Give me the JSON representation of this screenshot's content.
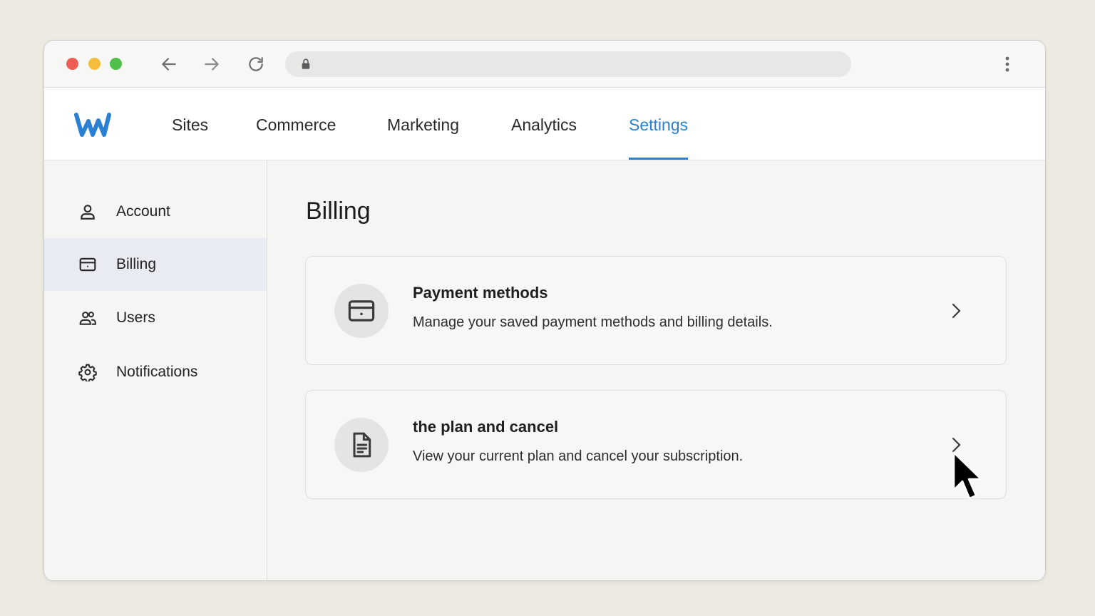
{
  "nav": {
    "tabs": [
      {
        "label": "Sites"
      },
      {
        "label": "Commerce"
      },
      {
        "label": "Marketing"
      },
      {
        "label": "Analytics"
      },
      {
        "label": "Settings",
        "active": true
      }
    ]
  },
  "sidebar": {
    "items": [
      {
        "label": "Account",
        "icon": "user-icon"
      },
      {
        "label": "Billing",
        "icon": "credit-card-icon",
        "active": true
      },
      {
        "label": "Users",
        "icon": "users-icon"
      },
      {
        "label": "Notifications",
        "icon": "gear-icon"
      }
    ]
  },
  "main": {
    "title": "Billing",
    "cards": [
      {
        "title": "Payment methods",
        "description": "Manage your saved payment methods and billing details.",
        "icon": "credit-card-icon"
      },
      {
        "title": "the plan and cancel",
        "description": "View your current plan and cancel your subscription.",
        "icon": "document-icon"
      }
    ]
  },
  "colors": {
    "accent": "#2a80d2",
    "background": "#edeae1",
    "sidebar_active": "#e8ecf2"
  }
}
